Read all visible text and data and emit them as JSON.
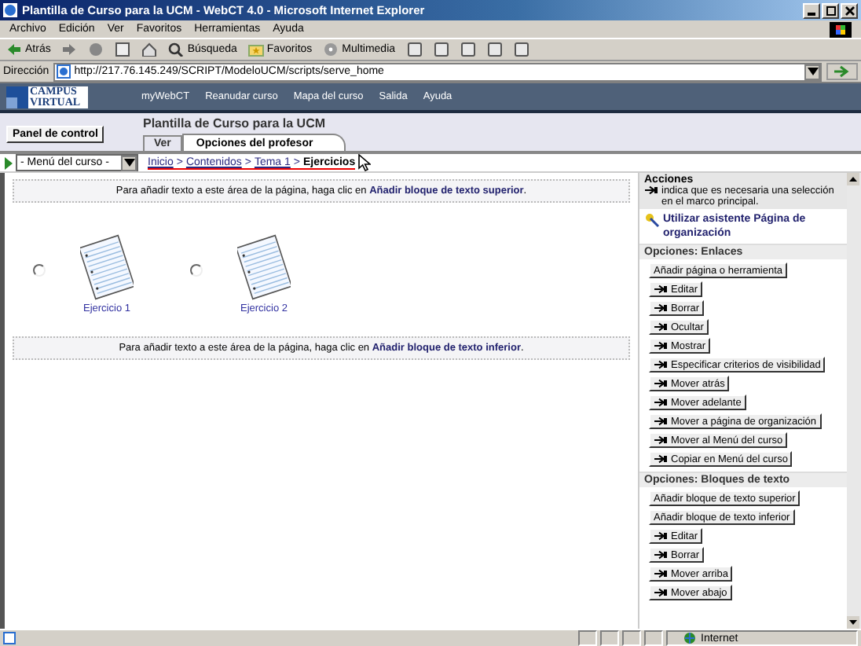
{
  "window": {
    "title": "Plantilla de Curso para la UCM - WebCT 4.0 - Microsoft Internet Explorer"
  },
  "menu": [
    "Archivo",
    "Edición",
    "Ver",
    "Favoritos",
    "Herramientas",
    "Ayuda"
  ],
  "toolbar": [
    {
      "kind": "back",
      "label": "Atrás"
    },
    {
      "kind": "forward"
    },
    {
      "kind": "search",
      "label": "Búsqueda"
    },
    {
      "kind": "favorites",
      "label": "Favoritos"
    },
    {
      "kind": "media",
      "label": "Multimedia"
    }
  ],
  "address": {
    "label": "Dirección",
    "value": "http://217.76.145.249/SCRIPT/ModeloUCM/scripts/serve_home"
  },
  "webct": {
    "logo": [
      "CAMPUS",
      "VIRTUAL"
    ],
    "nav": [
      "myWebCT",
      "Reanudar curso",
      "Mapa del curso",
      "Salida",
      "Ayuda"
    ]
  },
  "header": {
    "panel_button": "Panel de control",
    "course_title": "Plantilla de Curso para la UCM",
    "tabs": [
      {
        "label": "Ver",
        "selected": false
      },
      {
        "label": "Opciones del profesor",
        "selected": true
      }
    ]
  },
  "course_menu": "- Menú del curso -",
  "breadcrumb": {
    "separator": ">",
    "items": [
      {
        "label": "Inicio",
        "selected": false
      },
      {
        "label": "Contenidos",
        "selected": false
      },
      {
        "label": "Tema 1",
        "selected": false
      },
      {
        "label": "Ejercicios",
        "selected": true
      }
    ]
  },
  "text_blocks": [
    {
      "text": "Para añadir texto a este área de la página, haga clic en ",
      "link": "Añadir bloque de texto superior",
      "end": "."
    },
    {
      "text": "Para añadir texto a este área de la página, haga clic en ",
      "link": "Añadir bloque de texto inferior",
      "end": "."
    }
  ],
  "items": [
    {
      "label": "Ejercicio 1",
      "selected": false
    },
    {
      "label": "Ejercicio 2",
      "selected": false
    }
  ],
  "sidebar": {
    "title": "Acciones",
    "note": "indica que es necesaria una selección en el marco principal.",
    "wizard": "Utilizar asistente Página de organización",
    "sections": [
      {
        "title": "Opciones: Enlaces",
        "buttons": [
          {
            "label": "Añadir página o herramienta",
            "needs_selection": false
          },
          {
            "label": "Editar",
            "needs_selection": true
          },
          {
            "label": "Borrar",
            "needs_selection": true
          },
          {
            "label": "Ocultar",
            "needs_selection": true
          },
          {
            "label": "Mostrar",
            "needs_selection": true
          },
          {
            "label": "Especificar criterios de visibilidad",
            "needs_selection": true
          },
          {
            "label": "Mover atrás",
            "needs_selection": true
          },
          {
            "label": "Mover adelante",
            "needs_selection": true
          },
          {
            "label": "Mover a página de organización",
            "needs_selection": true
          },
          {
            "label": "Mover al Menú del curso",
            "needs_selection": true
          },
          {
            "label": "Copiar en Menú del curso",
            "needs_selection": true
          }
        ]
      },
      {
        "title": "Opciones: Bloques de texto",
        "buttons": [
          {
            "label": "Añadir bloque de texto superior",
            "needs_selection": false
          },
          {
            "label": "Añadir bloque de texto inferior",
            "needs_selection": false
          },
          {
            "label": "Editar",
            "needs_selection": true
          },
          {
            "label": "Borrar",
            "needs_selection": true
          },
          {
            "label": "Mover arriba",
            "needs_selection": true
          },
          {
            "label": "Mover abajo",
            "needs_selection": true
          }
        ]
      }
    ]
  },
  "status_bar": {
    "zone": "Internet"
  }
}
